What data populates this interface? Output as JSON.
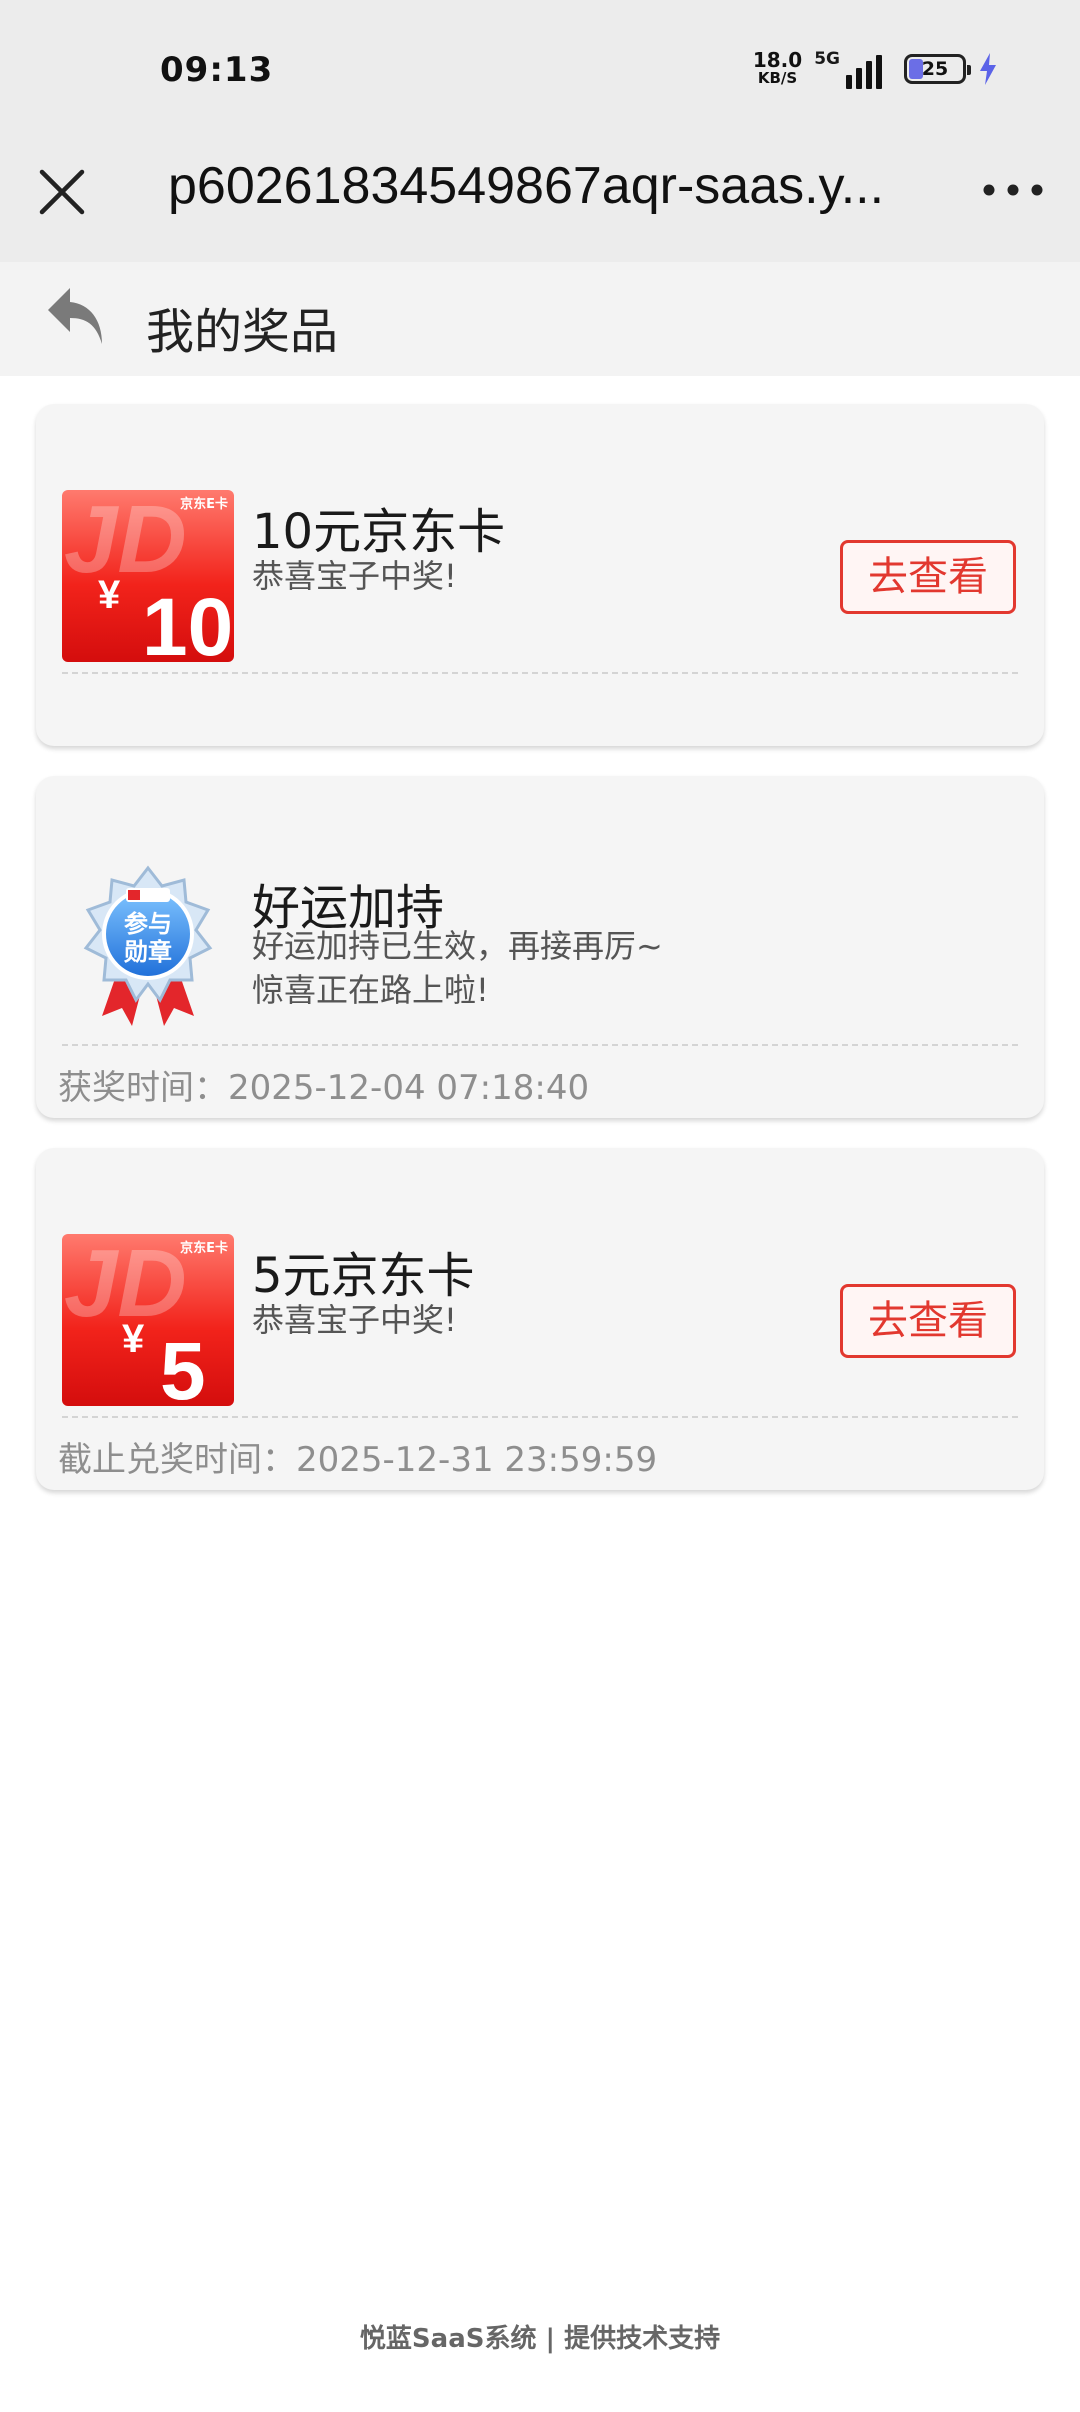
{
  "status_bar": {
    "time": "09:13",
    "net_speed": "18.0",
    "net_unit": "KB/S",
    "network": "5G",
    "battery": "25",
    "charging": true
  },
  "nav": {
    "url_title": "p60261834549867aqr-saas.y...",
    "close_icon": "close-icon",
    "more_icon": "more-icon"
  },
  "page": {
    "title": "我的奖品",
    "back_icon": "back-arrow-icon"
  },
  "prizes": [
    {
      "name": "10元京东卡",
      "desc": "恭喜宝子中奖!",
      "action": "去查看",
      "thumb": {
        "brand": "京东E卡",
        "currency": "¥",
        "amount": "10"
      }
    },
    {
      "name": "好运加持",
      "desc_line1": "好运加持已生效，再接再厉~",
      "desc_line2": "惊喜正在路上啦!",
      "meta": "获奖时间：2025-12-04 07:18:40",
      "badge": {
        "line1": "参与",
        "line2": "勋章"
      }
    },
    {
      "name": "5元京东卡",
      "desc": "恭喜宝子中奖!",
      "action": "去查看",
      "meta": "截止兑奖时间：2025-12-31 23:59:59",
      "thumb": {
        "brand": "京东E卡",
        "currency": "¥",
        "amount": "5"
      }
    }
  ],
  "footer": "悦蓝SaaS系统 | 提供技术支持",
  "colors": {
    "accent": "#e2382f",
    "card_bg": "#f5f5f5",
    "header_bg": "#ececec"
  }
}
